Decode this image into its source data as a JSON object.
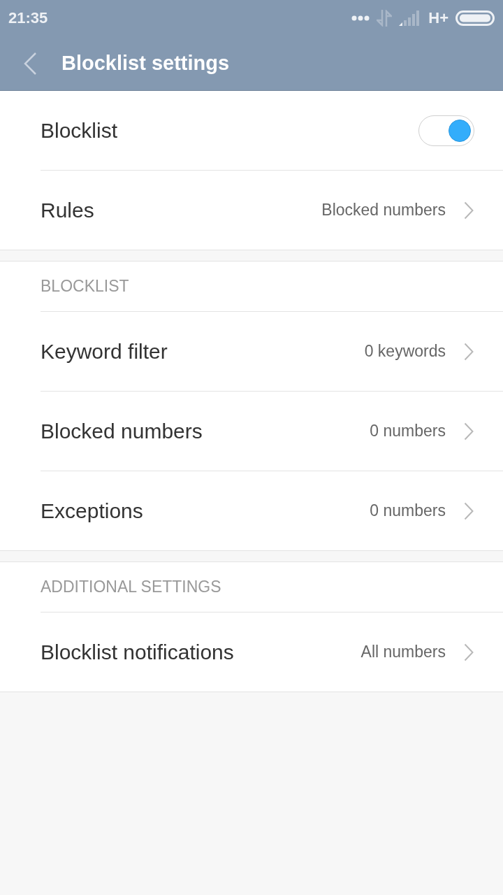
{
  "status_bar": {
    "time": "21:35",
    "network_type": "H+"
  },
  "header": {
    "title": "Blocklist settings"
  },
  "sections": [
    {
      "rows": [
        {
          "kind": "toggle",
          "label": "Blocklist",
          "on": true
        },
        {
          "kind": "link",
          "label": "Rules",
          "value": "Blocked numbers"
        }
      ]
    },
    {
      "header": "BLOCKLIST",
      "rows": [
        {
          "kind": "link",
          "label": "Keyword filter",
          "value": "0 keywords"
        },
        {
          "kind": "link",
          "label": "Blocked numbers",
          "value": "0 numbers"
        },
        {
          "kind": "link",
          "label": "Exceptions",
          "value": "0 numbers"
        }
      ]
    },
    {
      "header": "ADDITIONAL SETTINGS",
      "rows": [
        {
          "kind": "link",
          "label": "Blocklist notifications",
          "value": "All numbers"
        }
      ]
    }
  ]
}
